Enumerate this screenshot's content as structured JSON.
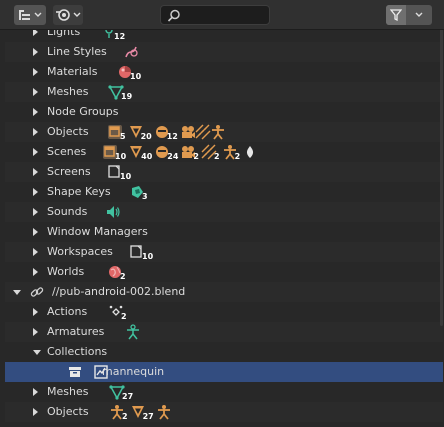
{
  "colors": {
    "orange": "#e09a4f",
    "teal": "#41c2a0",
    "red": "#e06767",
    "pink": "#e88aa6",
    "selection": "#334d80"
  },
  "header": {
    "display_mode_icon": "outliner-display-icon",
    "filter_icon": "funnel-icon",
    "search": {
      "placeholder": "",
      "icon": "search-icon"
    }
  },
  "rows": [
    {
      "label": "Lights",
      "expander": "collapsed",
      "icons": [
        {
          "name": "light-icon",
          "count": "12"
        }
      ]
    },
    {
      "label": "Line Styles",
      "expander": "collapsed",
      "icons": [
        {
          "name": "linestyle-icon",
          "count": ""
        }
      ]
    },
    {
      "label": "Materials",
      "expander": "collapsed",
      "icons": [
        {
          "name": "material-icon",
          "count": "10"
        }
      ]
    },
    {
      "label": "Meshes",
      "expander": "collapsed",
      "icons": [
        {
          "name": "mesh-icon",
          "count": "19"
        }
      ]
    },
    {
      "label": "Node Groups",
      "expander": "collapsed",
      "icons": []
    },
    {
      "label": "Objects",
      "expander": "collapsed",
      "icons": [
        {
          "name": "object-data-icon",
          "count": "5"
        },
        {
          "name": "mesh-object-icon",
          "count": "20"
        },
        {
          "name": "face-object-icon",
          "count": "12"
        },
        {
          "name": "camera-icon",
          "count": ""
        },
        {
          "name": "hair-icon",
          "count": ""
        },
        {
          "name": "armature-object-icon",
          "count": ""
        }
      ]
    },
    {
      "label": "Scenes",
      "expander": "collapsed",
      "icons": [
        {
          "name": "scene-data-icon",
          "count": "10"
        },
        {
          "name": "mesh-object-icon",
          "count": "40"
        },
        {
          "name": "face-object-icon",
          "count": "24"
        },
        {
          "name": "camera-icon",
          "count": "2"
        },
        {
          "name": "hair-icon",
          "count": "2"
        },
        {
          "name": "armature-object-icon",
          "count": "2"
        },
        {
          "name": "light-object-icon",
          "count": ""
        }
      ]
    },
    {
      "label": "Screens",
      "expander": "collapsed",
      "icons": [
        {
          "name": "screen-icon",
          "count": "10"
        }
      ]
    },
    {
      "label": "Shape Keys",
      "expander": "collapsed",
      "icons": [
        {
          "name": "shapekey-icon",
          "count": "3"
        }
      ]
    },
    {
      "label": "Sounds",
      "expander": "collapsed",
      "icons": [
        {
          "name": "speaker-icon",
          "count": ""
        }
      ]
    },
    {
      "label": "Window Managers",
      "expander": "collapsed",
      "icons": []
    },
    {
      "label": "Workspaces",
      "expander": "collapsed",
      "icons": [
        {
          "name": "workspace-icon",
          "count": "10"
        }
      ]
    },
    {
      "label": "Worlds",
      "expander": "collapsed",
      "icons": [
        {
          "name": "world-icon",
          "count": "2"
        }
      ]
    },
    {
      "label": "//pub-android-002.blend",
      "expander": "expanded",
      "icons": []
    },
    {
      "label": "Actions",
      "expander": "collapsed",
      "icons": [
        {
          "name": "action-icon",
          "count": "2"
        }
      ]
    },
    {
      "label": "Armatures",
      "expander": "collapsed",
      "icons": [
        {
          "name": "armature-data-icon",
          "count": ""
        }
      ]
    },
    {
      "label": "Collections",
      "expander": "expanded",
      "icons": []
    },
    {
      "label": "mannequin",
      "expander": "none",
      "icons": []
    },
    {
      "label": "Meshes",
      "expander": "collapsed",
      "icons": [
        {
          "name": "mesh-icon",
          "count": "27"
        }
      ]
    },
    {
      "label": "Objects",
      "expander": "collapsed",
      "icons": [
        {
          "name": "armature-object-icon",
          "count": "2"
        },
        {
          "name": "mesh-object-icon",
          "count": "27"
        },
        {
          "name": "armature-object-icon",
          "count": ""
        }
      ]
    }
  ]
}
